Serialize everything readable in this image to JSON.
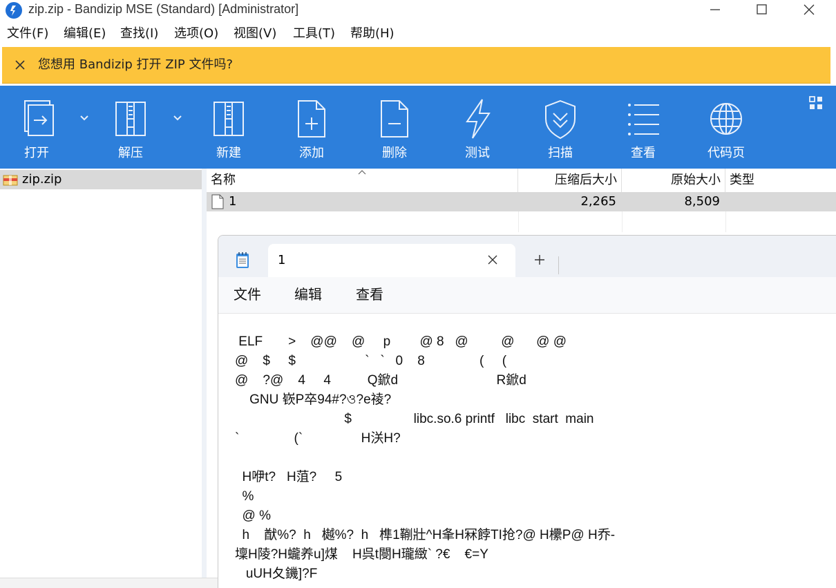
{
  "window": {
    "title": "zip.zip - Bandizip MSE (Standard) [Administrator]"
  },
  "menu": [
    "文件(F)",
    "编辑(E)",
    "查找(I)",
    "选项(O)",
    "视图(V)",
    "工具(T)",
    "帮助(H)"
  ],
  "infobar": {
    "message": "您想用 Bandizip 打开 ZIP 文件吗?"
  },
  "toolbar": {
    "open": "打开",
    "extract": "解压",
    "new": "新建",
    "add": "添加",
    "delete": "删除",
    "test": "测试",
    "scan": "扫描",
    "view": "查看",
    "codepage": "代码页"
  },
  "tree": {
    "root": "zip.zip"
  },
  "list": {
    "columns": [
      "名称",
      "压缩后大小",
      "原始大小",
      "类型"
    ],
    "rows": [
      {
        "name": "1",
        "compressed": "2,265",
        "original": "8,509",
        "type": ""
      }
    ]
  },
  "notepad": {
    "tab_title": "1",
    "menu": [
      "文件",
      "编辑",
      "查看"
    ],
    "lines": [
      " ELF\u0002\u0001\u0001      \u0003 > \u0001   @\u0001@    @     p\u0001        @ 8   @ \u0001 \u0001 \u0001   \u0001   @      @ @",
      "@    $     $           \u0001  \u0001  \u0001\u0001    \u0001\u0001`   \u0001\u0001`   0\u0001    8\u0001          \u0001   \u0001  (\u0001     (\u0001",
      "@    ?@    4     4     \u0001     Q鍁d\u0001                      \u0001     R鍁d\u0001  \u0001\u0001",
      "\u0001  \u0001  GNU 嵚P卒9\u00014#?ও?e祾?  \u0001  \u0001",
      "  \u0001             \u0001  \u0001             $                 libc.so.6 printf   libc  start  main",
      "\u0001`       \u0001        (\u0001`       \u0001         H浂\u0001H?",
      "",
      "  H咿t\u0001?   H菹\u0001?     \u00015\u0001",
      "  \u0001%\u0001",
      "  \u0001\u0001@ \u0001%\u0001",
      "  h    猷\u0001\u0001\u0001\u0001%?  h\u0001   樾\u0001\u0001\u0001\u0001%?  h\u0001   榫\u0001\u0001\u00011鞩壯^H夆H冧餑TI抢?@ H欙P\u0001@ H乔-",
      "壈H陵?H\u0001蠬养u\u0001]煤    H呉t閿H瓏緻\u0001` \u0001?\u0001€    €=Y",
      "   u\u0001UH夂鐖\u0001\u0001\u0001]?F"
    ]
  },
  "colors": {
    "toolbar_bg": "#2d7fdb",
    "infobar_bg": "#fcc43c",
    "selection_bg": "#d9d9d9"
  },
  "icons": [
    "app-logo-icon",
    "minimize-icon",
    "maximize-icon",
    "close-icon",
    "open-icon",
    "extract-icon",
    "new-archive-icon",
    "add-icon",
    "delete-icon",
    "test-icon",
    "scan-icon",
    "view-icon",
    "codepage-icon",
    "layout-icon",
    "zip-file-icon",
    "file-icon",
    "notepad-icon",
    "plus-icon"
  ]
}
